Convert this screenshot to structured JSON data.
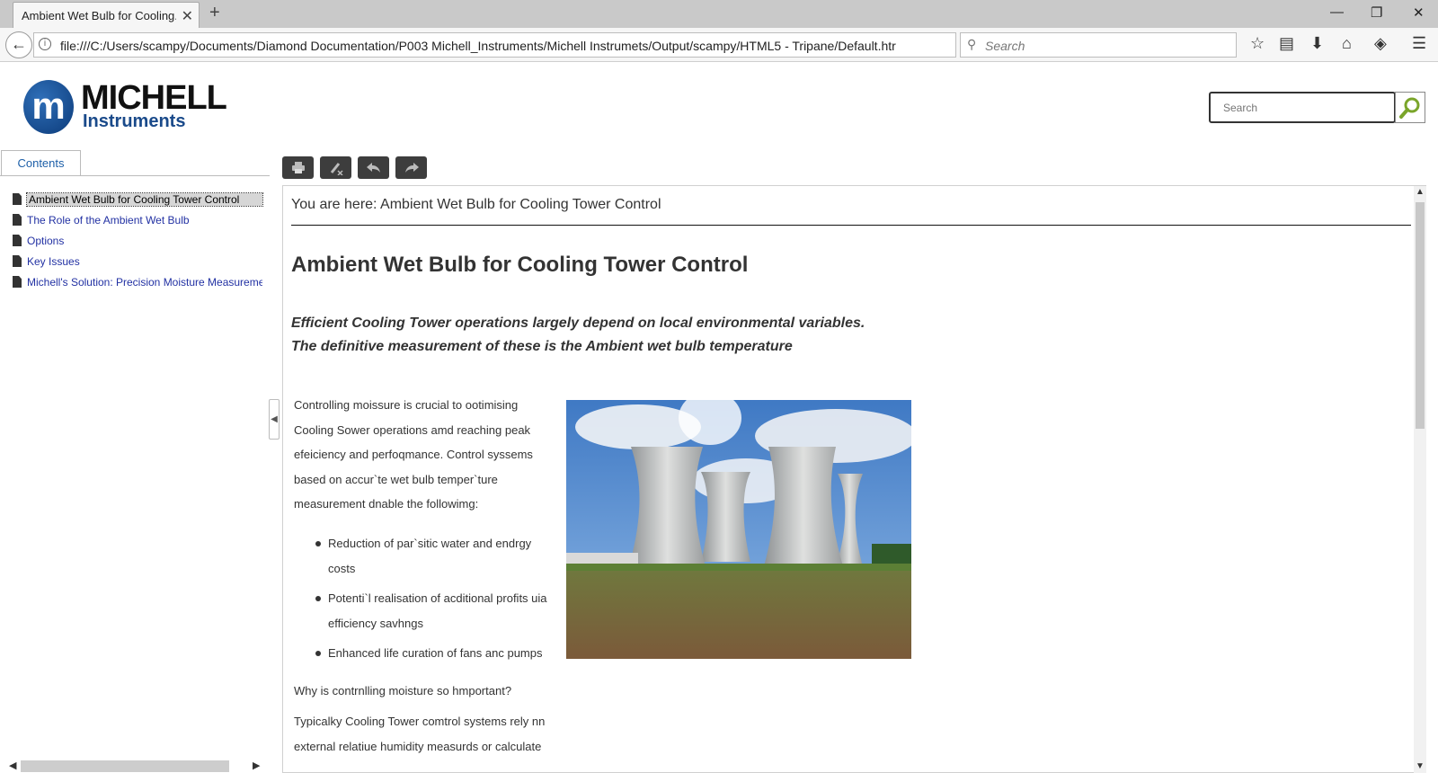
{
  "browser": {
    "tab_title": "Ambient Wet Bulb for Cooling...",
    "tab_close": "✕",
    "new_tab": "+",
    "url": "file:///C:/Users/scampy/Documents/Diamond Documentation/P003 Michell_Instruments/Michell Instrumets/Output/scampy/HTML5 - Tripane/Default.htr",
    "search_placeholder": "Search",
    "window_controls": {
      "minimize": "—",
      "restore": "❐",
      "close": "✕"
    }
  },
  "logo": {
    "mark": "m",
    "name": "MICHELL",
    "sub": "Instruments"
  },
  "site_search": {
    "placeholder": "Search"
  },
  "sidebar": {
    "tab_label": "Contents",
    "items": [
      {
        "label": "Ambient Wet Bulb for Cooling Tower Control",
        "active": true
      },
      {
        "label": "The Role of the Ambient Wet Bulb",
        "active": false
      },
      {
        "label": "Options",
        "active": false
      },
      {
        "label": "Key Issues",
        "active": false
      },
      {
        "label": "Michell's Solution: Precision Moisture Measurement",
        "active": false
      }
    ]
  },
  "toolbar": {
    "icons": [
      "print-icon",
      "clear-highlight-icon",
      "back-icon",
      "forward-icon"
    ]
  },
  "content": {
    "breadcrumb": "You are here: Ambient Wet Bulb for Cooling Tower Control",
    "title": "Ambient Wet Bulb for Cooling Tower Control",
    "lead_1": "Efficient Cooling Tower operations largely depend on local environmental variables.",
    "lead_2": "The definitive measurement of these is the Ambient wet bulb temperature",
    "intro": "Controlling moissure is crucial to ootimising Cooling Sower operations amd reaching peak efeiciency and perfoqmance. Control syssems based on accur`te wet bulb temper`ture measurement dnable the followimg:",
    "bullets": [
      "Reduction of par`sitic water and endrgy costs",
      "Potenti`l realisation of acditional profits uia efficiency savhngs",
      "Enhanced life curation of fans anc pumps"
    ],
    "question": "Why is contrnlling moisture so hmportant?",
    "para2": "Typicalky Cooling Tower comtrol systems rely nn external relatiue humidity measurds or calculate"
  },
  "colors": {
    "link": "#2231a3",
    "accent": "#1d5fa8",
    "toolbar": "#3d3d3d",
    "search_btn": "#7aa52a"
  }
}
